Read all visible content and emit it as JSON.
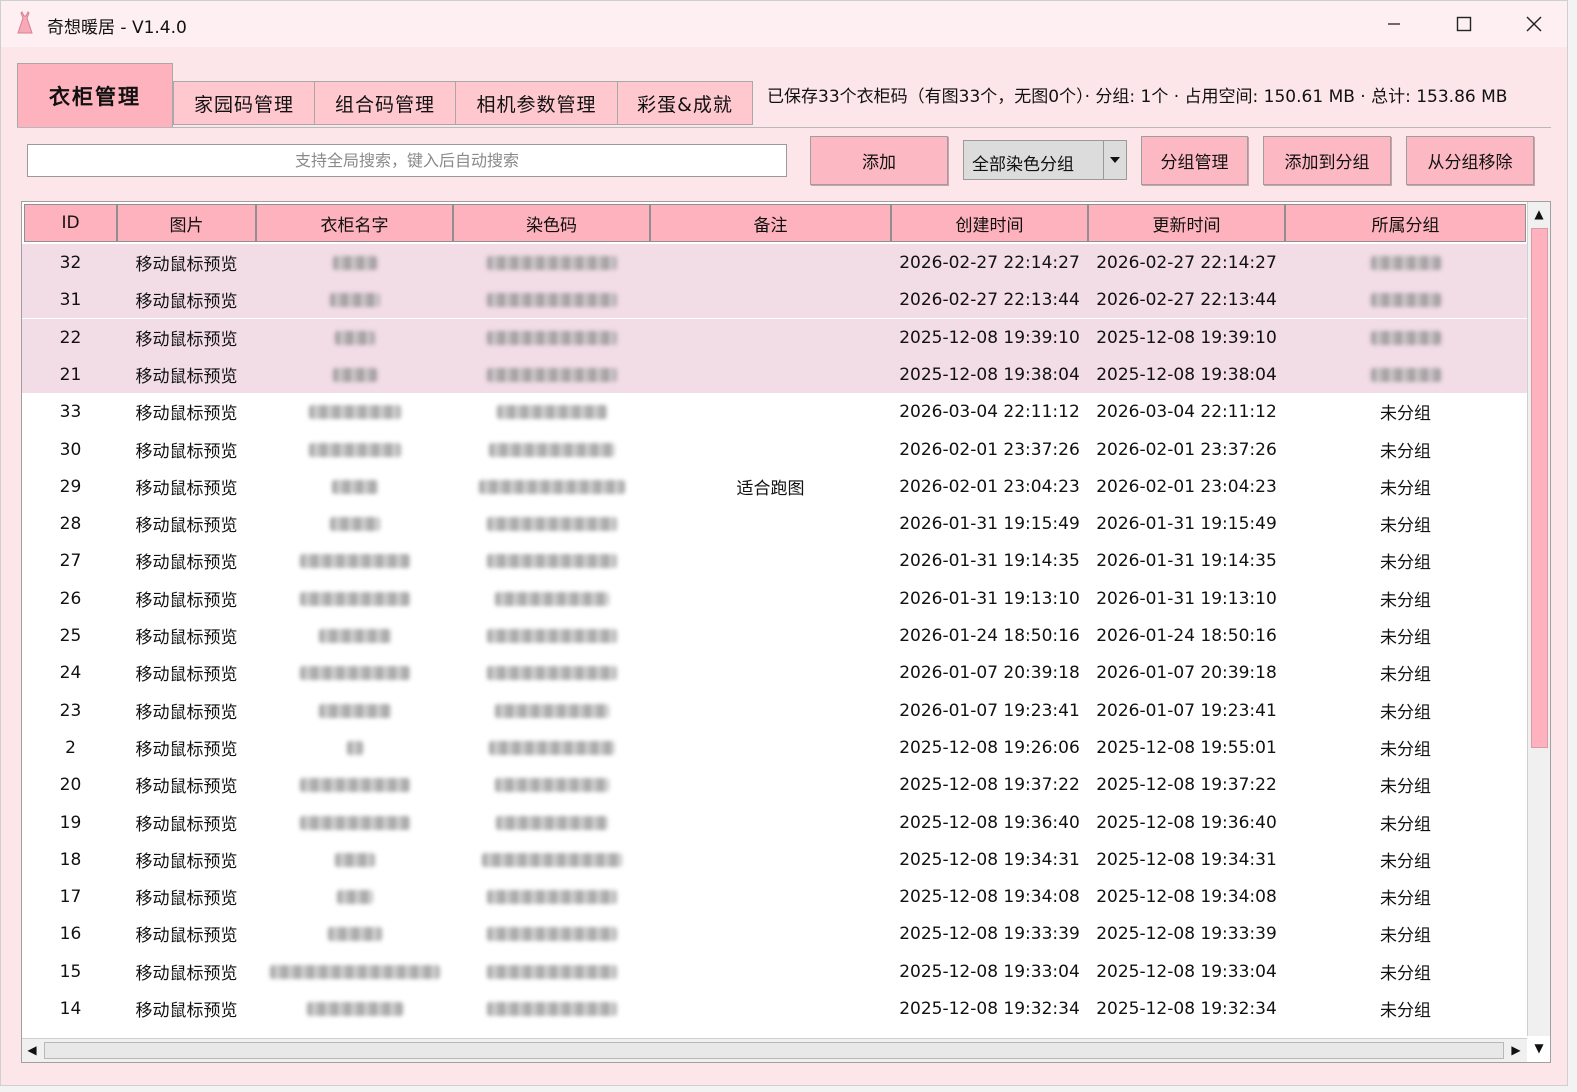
{
  "window": {
    "title": "奇想暖居 - V1.4.0",
    "icon": "dress-icon",
    "controls": [
      "minimize-icon",
      "maximize-icon",
      "close-icon"
    ]
  },
  "tabs": [
    {
      "label": "衣柜管理",
      "active": true
    },
    {
      "label": "家园码管理",
      "active": false
    },
    {
      "label": "组合码管理",
      "active": false
    },
    {
      "label": "相机参数管理",
      "active": false
    },
    {
      "label": "彩蛋&成就",
      "active": false
    }
  ],
  "status": "已保存33个衣柜码（有图33个，无图0个）· 分组: 1个 · 占用空间: 150.61 MB · 总计: 153.86 MB",
  "toolbar": {
    "search_placeholder": "支持全局搜索，键入后自动搜索",
    "search_value": "",
    "add_label": "添加",
    "group_select_value": "全部染色分组",
    "group_manage_label": "分组管理",
    "add_to_group_label": "添加到分组",
    "remove_from_group_label": "从分组移除"
  },
  "table": {
    "columns": [
      "ID",
      "图片",
      "衣柜名字",
      "染色码",
      "备注",
      "创建时间",
      "更新时间",
      "所属分组"
    ],
    "rows": [
      {
        "id": "32",
        "image": "移动鼠标预览",
        "name": "",
        "code": "",
        "note": "",
        "created": "2026-02-27 22:14:27",
        "updated": "2026-02-27 22:14:27",
        "group": "",
        "grouped": true
      },
      {
        "id": "31",
        "image": "移动鼠标预览",
        "name": "",
        "code": "",
        "note": "",
        "created": "2026-02-27 22:13:44",
        "updated": "2026-02-27 22:13:44",
        "group": "",
        "grouped": true
      },
      {
        "id": "22",
        "image": "移动鼠标预览",
        "name": "",
        "code": "",
        "note": "",
        "created": "2025-12-08 19:39:10",
        "updated": "2025-12-08 19:39:10",
        "group": "",
        "grouped": true
      },
      {
        "id": "21",
        "image": "移动鼠标预览",
        "name": "",
        "code": "",
        "note": "",
        "created": "2025-12-08 19:38:04",
        "updated": "2025-12-08 19:38:04",
        "group": "",
        "grouped": true
      },
      {
        "id": "33",
        "image": "移动鼠标预览",
        "name": "",
        "code": "",
        "note": "",
        "created": "2026-03-04 22:11:12",
        "updated": "2026-03-04 22:11:12",
        "group": "未分组",
        "grouped": false
      },
      {
        "id": "30",
        "image": "移动鼠标预览",
        "name": "",
        "code": "",
        "note": "",
        "created": "2026-02-01 23:37:26",
        "updated": "2026-02-01 23:37:26",
        "group": "未分组",
        "grouped": false
      },
      {
        "id": "29",
        "image": "移动鼠标预览",
        "name": "",
        "code": "",
        "note": "适合跑图",
        "created": "2026-02-01 23:04:23",
        "updated": "2026-02-01 23:04:23",
        "group": "未分组",
        "grouped": false
      },
      {
        "id": "28",
        "image": "移动鼠标预览",
        "name": "",
        "code": "",
        "note": "",
        "created": "2026-01-31 19:15:49",
        "updated": "2026-01-31 19:15:49",
        "group": "未分组",
        "grouped": false
      },
      {
        "id": "27",
        "image": "移动鼠标预览",
        "name": "",
        "code": "",
        "note": "",
        "created": "2026-01-31 19:14:35",
        "updated": "2026-01-31 19:14:35",
        "group": "未分组",
        "grouped": false
      },
      {
        "id": "26",
        "image": "移动鼠标预览",
        "name": "",
        "code": "",
        "note": "",
        "created": "2026-01-31 19:13:10",
        "updated": "2026-01-31 19:13:10",
        "group": "未分组",
        "grouped": false
      },
      {
        "id": "25",
        "image": "移动鼠标预览",
        "name": "",
        "code": "",
        "note": "",
        "created": "2026-01-24 18:50:16",
        "updated": "2026-01-24 18:50:16",
        "group": "未分组",
        "grouped": false
      },
      {
        "id": "24",
        "image": "移动鼠标预览",
        "name": "",
        "code": "",
        "note": "",
        "created": "2026-01-07 20:39:18",
        "updated": "2026-01-07 20:39:18",
        "group": "未分组",
        "grouped": false
      },
      {
        "id": "23",
        "image": "移动鼠标预览",
        "name": "",
        "code": "",
        "note": "",
        "created": "2026-01-07 19:23:41",
        "updated": "2026-01-07 19:23:41",
        "group": "未分组",
        "grouped": false
      },
      {
        "id": "2",
        "image": "移动鼠标预览",
        "name": "",
        "code": "",
        "note": "",
        "created": "2025-12-08 19:26:06",
        "updated": "2025-12-08 19:55:01",
        "group": "未分组",
        "grouped": false
      },
      {
        "id": "20",
        "image": "移动鼠标预览",
        "name": "",
        "code": "",
        "note": "",
        "created": "2025-12-08 19:37:22",
        "updated": "2025-12-08 19:37:22",
        "group": "未分组",
        "grouped": false
      },
      {
        "id": "19",
        "image": "移动鼠标预览",
        "name": "",
        "code": "",
        "note": "",
        "created": "2025-12-08 19:36:40",
        "updated": "2025-12-08 19:36:40",
        "group": "未分组",
        "grouped": false
      },
      {
        "id": "18",
        "image": "移动鼠标预览",
        "name": "",
        "code": "",
        "note": "",
        "created": "2025-12-08 19:34:31",
        "updated": "2025-12-08 19:34:31",
        "group": "未分组",
        "grouped": false
      },
      {
        "id": "17",
        "image": "移动鼠标预览",
        "name": "",
        "code": "",
        "note": "",
        "created": "2025-12-08 19:34:08",
        "updated": "2025-12-08 19:34:08",
        "group": "未分组",
        "grouped": false
      },
      {
        "id": "16",
        "image": "移动鼠标预览",
        "name": "",
        "code": "",
        "note": "",
        "created": "2025-12-08 19:33:39",
        "updated": "2025-12-08 19:33:39",
        "group": "未分组",
        "grouped": false
      },
      {
        "id": "15",
        "image": "移动鼠标预览",
        "name": "",
        "code": "",
        "note": "",
        "created": "2025-12-08 19:33:04",
        "updated": "2025-12-08 19:33:04",
        "group": "未分组",
        "grouped": false
      },
      {
        "id": "14",
        "image": "移动鼠标预览",
        "name": "",
        "code": "",
        "note": "",
        "created": "2025-12-08 19:32:34",
        "updated": "2025-12-08 19:32:34",
        "group": "未分组",
        "grouped": false
      }
    ]
  },
  "colors": {
    "accent": "#fdb2bd",
    "window_bg": "#fde6ea",
    "grouped_row": "#f2dce6"
  }
}
